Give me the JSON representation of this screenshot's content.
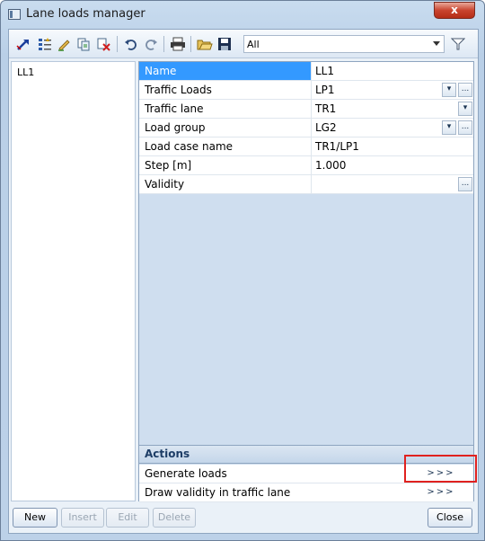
{
  "window": {
    "title": "Lane loads manager",
    "close_glyph": "x"
  },
  "toolbar": {
    "filter_value": "All",
    "icons": [
      "edit-pointer-icon",
      "properties-icon",
      "pencil-icon",
      "copy-icon",
      "delete-icon",
      "undo-icon",
      "redo-icon",
      "print-icon",
      "open-folder-icon",
      "save-icon",
      "filter-icon"
    ]
  },
  "tree": {
    "items": [
      {
        "label": "LL1"
      }
    ]
  },
  "properties": [
    {
      "name": "Name",
      "value": "LL1",
      "selected": true
    },
    {
      "name": "Traffic Loads",
      "value": "LP1"
    },
    {
      "name": "Traffic lane",
      "value": "TR1"
    },
    {
      "name": "Load group",
      "value": "LG2"
    },
    {
      "name": "Load case name",
      "value": "TR1/LP1"
    },
    {
      "name": "Step [m]",
      "value": "1.000"
    },
    {
      "name": "Validity",
      "value": ""
    }
  ],
  "actions": {
    "header": "Actions",
    "items": [
      {
        "label": "Generate loads",
        "button": ">>>"
      },
      {
        "label": "Draw validity in traffic lane",
        "button": ">>>"
      }
    ]
  },
  "buttons": {
    "new": "New",
    "insert": "Insert",
    "edit": "Edit",
    "delete": "Delete",
    "close": "Close"
  },
  "cell_buttons": {
    "dropdown": "▾",
    "ellipsis": "..."
  }
}
